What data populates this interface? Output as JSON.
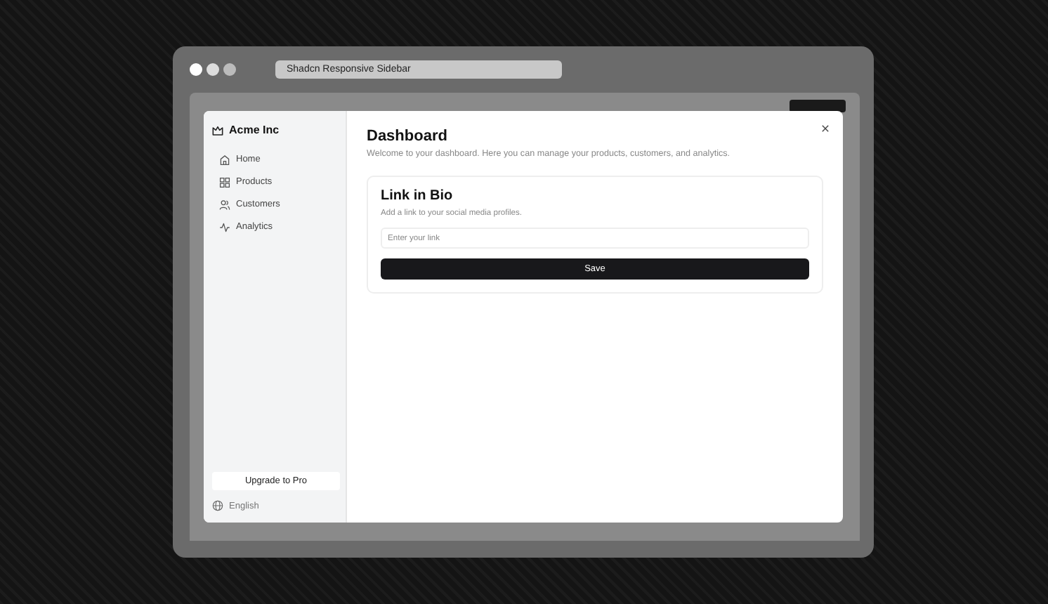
{
  "browser": {
    "tab_title": "Shadcn Responsive Sidebar"
  },
  "sidebar": {
    "brand": "Acme Inc",
    "items": [
      {
        "label": "Home",
        "kind": "home"
      },
      {
        "label": "Products",
        "kind": "grid"
      },
      {
        "label": "Customers",
        "kind": "users"
      },
      {
        "label": "Analytics",
        "kind": "chart"
      }
    ],
    "upgrade_button": "Upgrade to Pro",
    "language": "English"
  },
  "main": {
    "title": "Dashboard",
    "subtitle": "Welcome to your dashboard. Here you can manage your products, customers, and analytics.",
    "card": {
      "title": "Link in Bio",
      "description": "Add a link to your social media profiles.",
      "input": {
        "placeholder": "Enter your link"
      },
      "button": "Save"
    }
  }
}
